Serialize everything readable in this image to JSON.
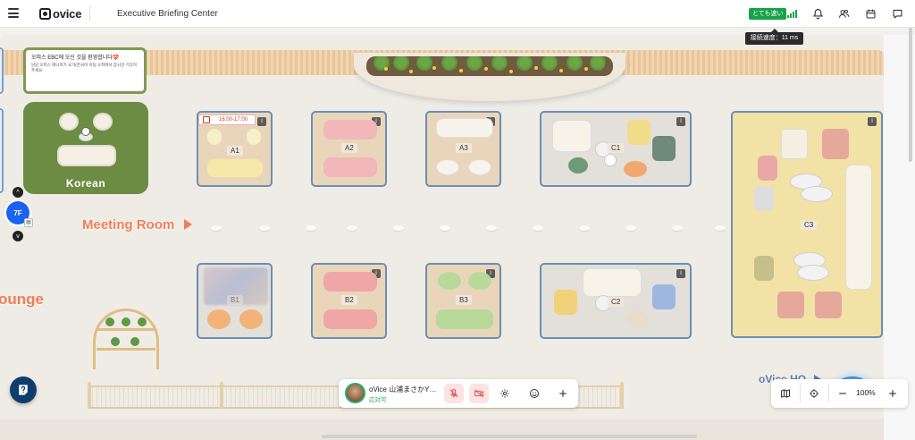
{
  "topbar": {
    "logo_text": "ovice",
    "space_title": "Executive Briefing Center",
    "speed_badge": "とても速い",
    "tooltip": "接続速度：11 ms",
    "buttons": [
      "bell-icon",
      "users-icon",
      "calendar-icon",
      "chat-icon"
    ]
  },
  "welcome": {
    "title": "오피스 EBC에 오신 것을 환영합니다💝",
    "subtitle": "담당 오피스 매니저가 요가(한국어 미팅 소파에서 잠시만 기다려주세요."
  },
  "zones": {
    "korean": "Korean",
    "meeting_room": "Meeting Room",
    "lounge": "ounge",
    "hq": "oVice HQ"
  },
  "floor": {
    "current": "7F",
    "up": "^",
    "down": "v",
    "mini": "▤"
  },
  "reservation": {
    "time": "16:00-17:00"
  },
  "rooms": {
    "a1": "A1",
    "a2": "A2",
    "a3": "A3",
    "c1": "C1",
    "c3": "C3",
    "b1": "B1",
    "b2": "B2",
    "b3": "B3",
    "c2": "C2",
    "badge": "i"
  },
  "user_bar": {
    "name": "oVice 山浦まさかY…",
    "status": "応対可"
  },
  "zoom": {
    "level": "100%"
  },
  "colors": {
    "accent": "#1a63f0",
    "online": "#27ae60",
    "label": "#ef7d5a",
    "room_border": "#6b8fb3"
  }
}
